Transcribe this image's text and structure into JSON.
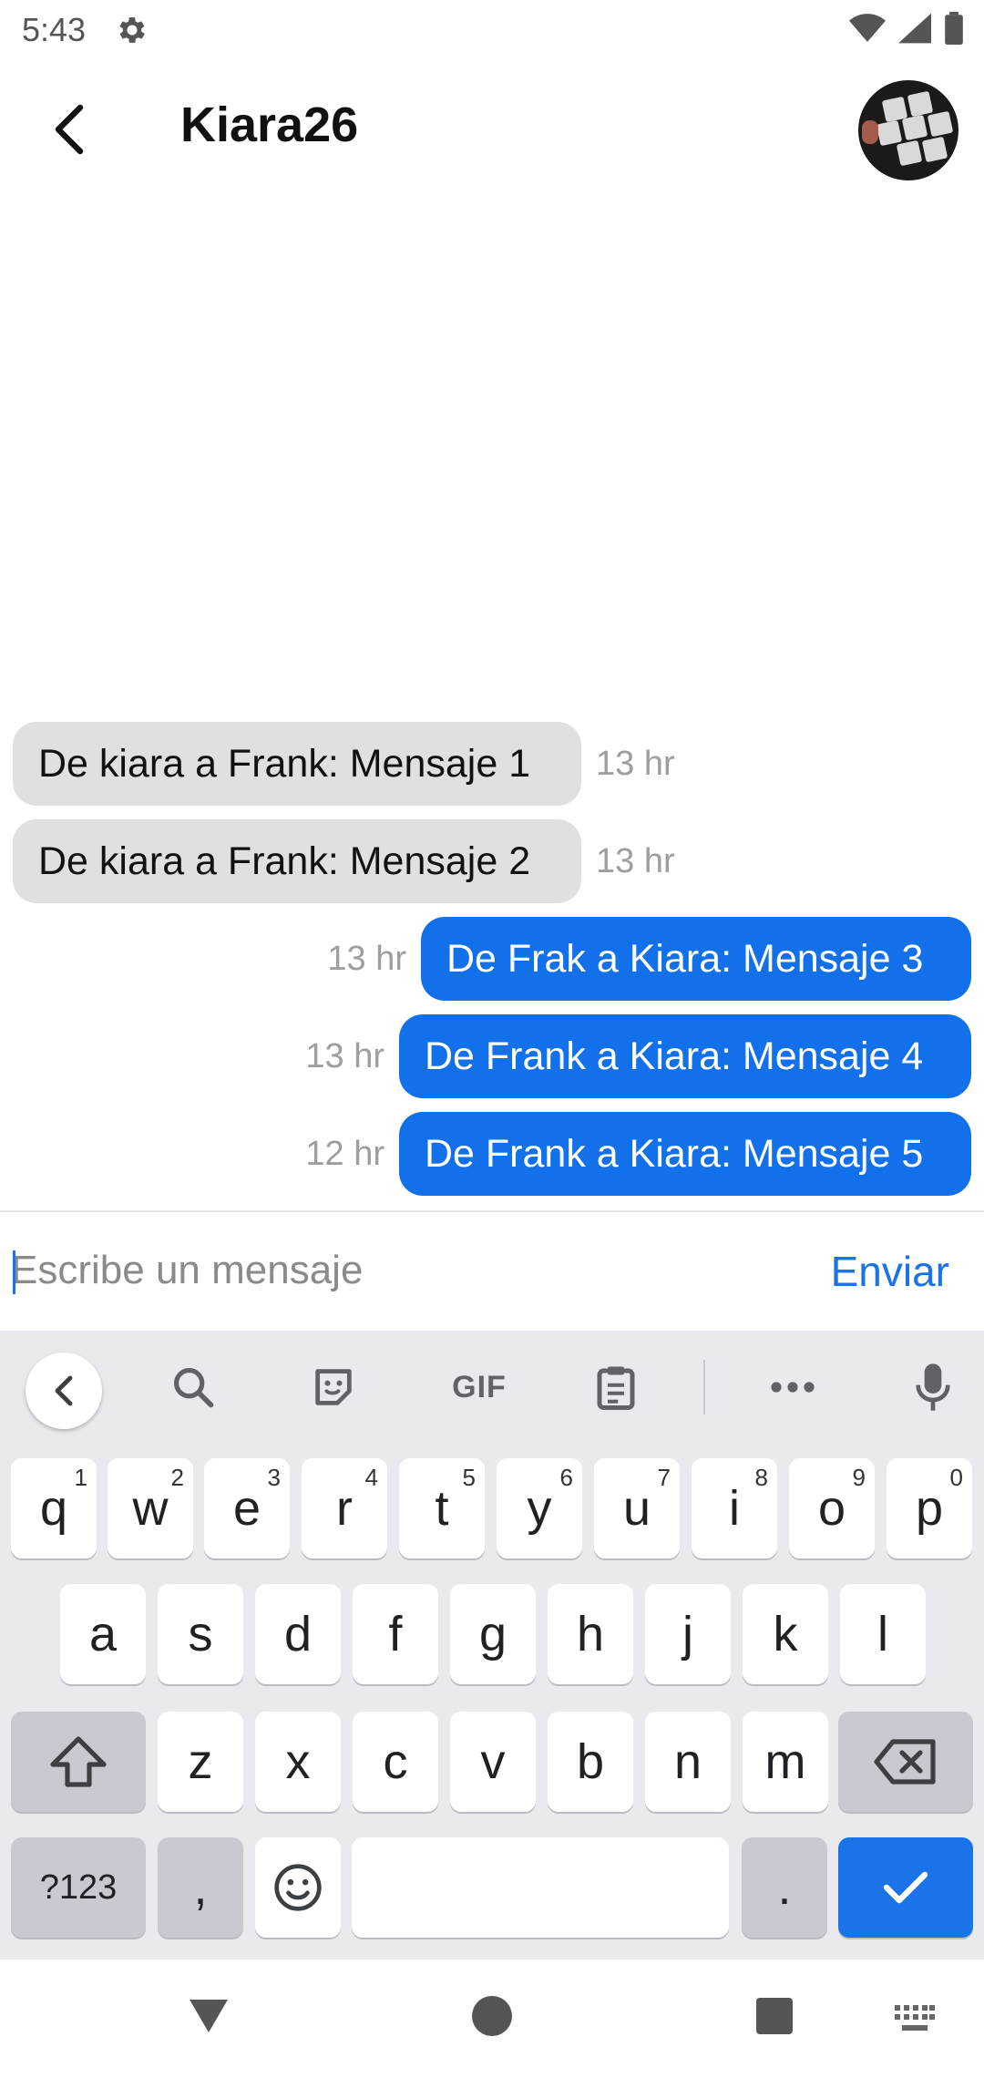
{
  "status_bar": {
    "time": "5:43"
  },
  "header": {
    "title": "Kiara26"
  },
  "messages": [
    {
      "text": "De kiara a Frank: Mensaje 1",
      "time": "13 hr",
      "direction": "incoming"
    },
    {
      "text": "De kiara a Frank: Mensaje 2",
      "time": "13 hr",
      "direction": "incoming"
    },
    {
      "text": "De Frak a Kiara: Mensaje 3",
      "time": "13 hr",
      "direction": "outgoing"
    },
    {
      "text": "De Frank a Kiara: Mensaje 4",
      "time": "13 hr",
      "direction": "outgoing"
    },
    {
      "text": "De Frank a Kiara: Mensaje 5",
      "time": "12 hr",
      "direction": "outgoing"
    }
  ],
  "composer": {
    "placeholder": "Escribe un mensaje",
    "send_label": "Enviar"
  },
  "keyboard": {
    "toolbar": {
      "gif_label": "GIF"
    },
    "row1": [
      {
        "key": "q",
        "hint": "1"
      },
      {
        "key": "w",
        "hint": "2"
      },
      {
        "key": "e",
        "hint": "3"
      },
      {
        "key": "r",
        "hint": "4"
      },
      {
        "key": "t",
        "hint": "5"
      },
      {
        "key": "y",
        "hint": "6"
      },
      {
        "key": "u",
        "hint": "7"
      },
      {
        "key": "i",
        "hint": "8"
      },
      {
        "key": "o",
        "hint": "9"
      },
      {
        "key": "p",
        "hint": "0"
      }
    ],
    "row2": [
      "a",
      "s",
      "d",
      "f",
      "g",
      "h",
      "j",
      "k",
      "l"
    ],
    "row3": [
      "z",
      "x",
      "c",
      "v",
      "b",
      "n",
      "m"
    ],
    "row4": {
      "symbols_label": "?123",
      "comma": ",",
      "period": "."
    }
  },
  "colors": {
    "accent": "#1a73e8",
    "outgoing_bubble": "#1170ea",
    "incoming_bubble": "#e0e0e0"
  }
}
